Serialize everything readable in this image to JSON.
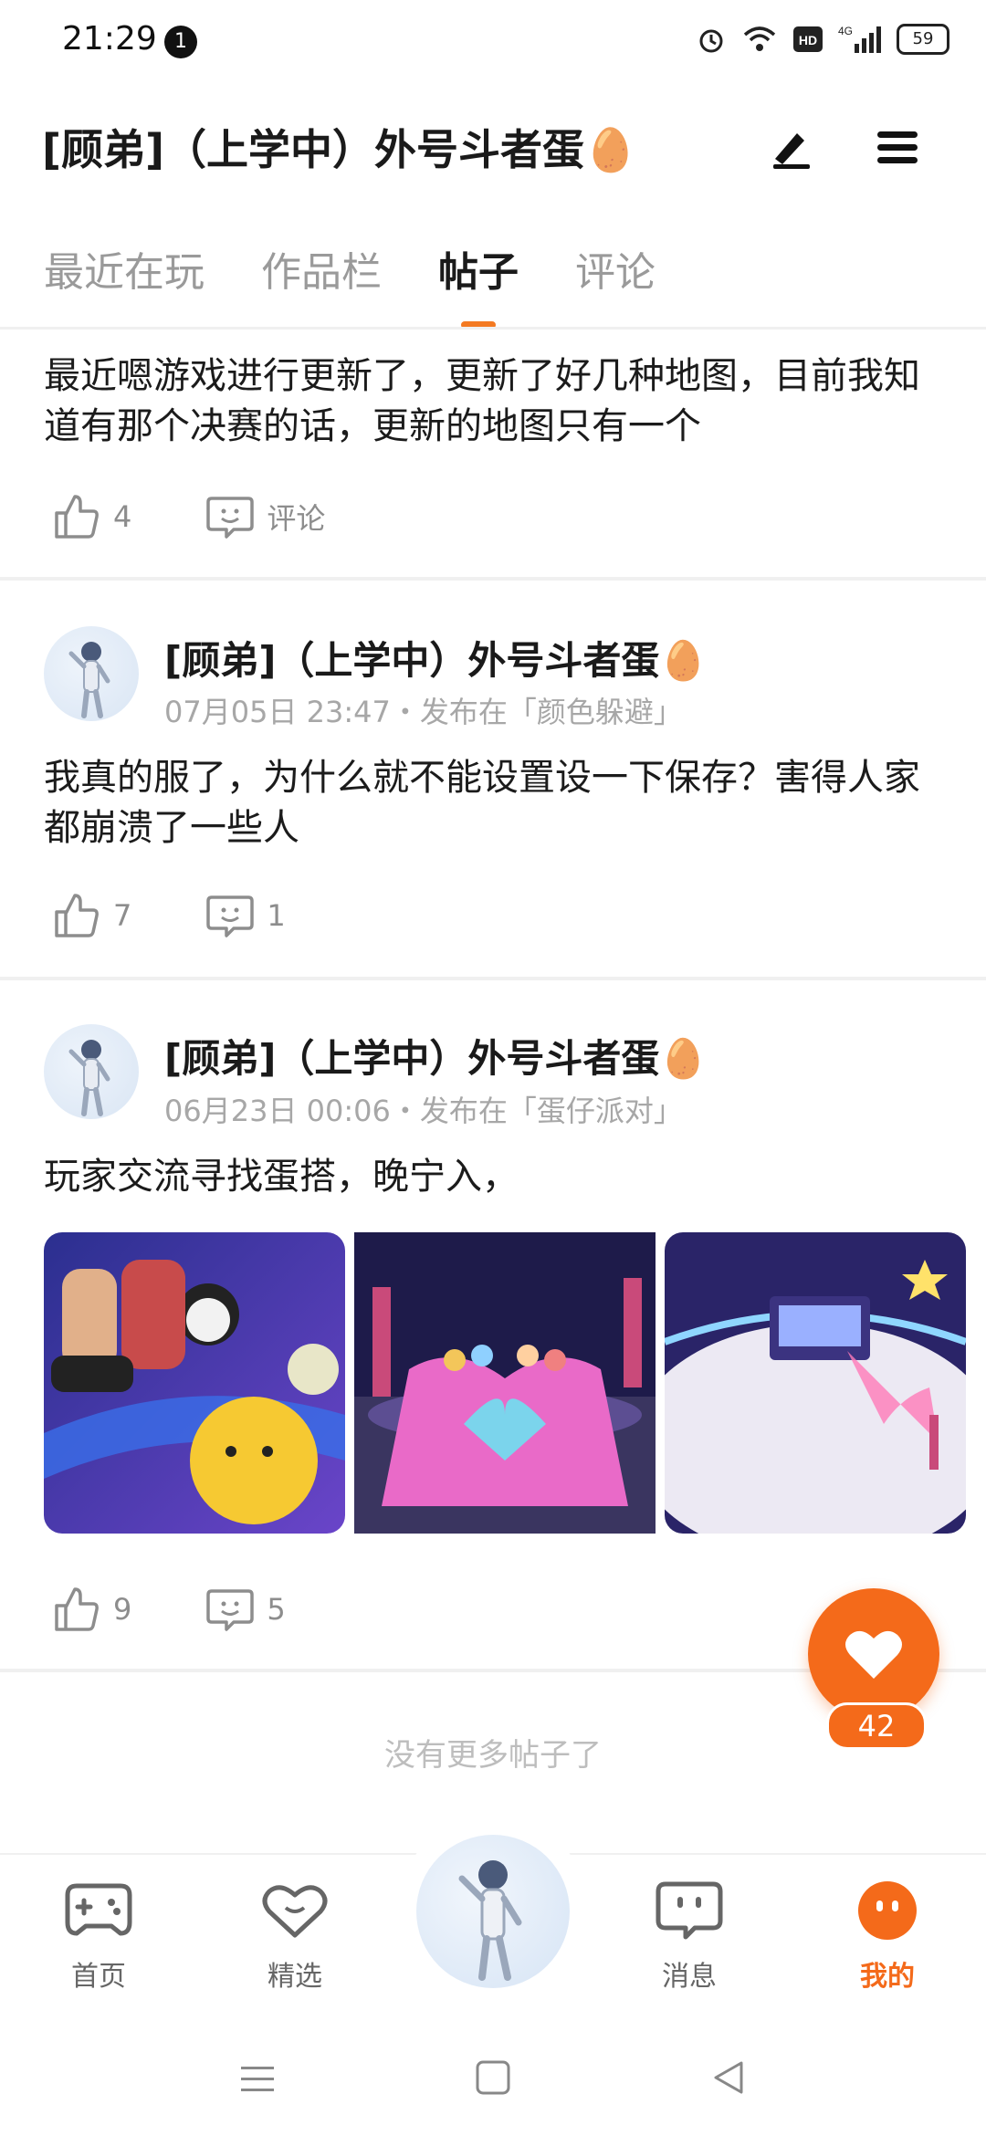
{
  "status_bar": {
    "time": "21:29",
    "notification_count": "1",
    "battery": "59",
    "network": "4G"
  },
  "header": {
    "title": "[顾弟]（上学中）外号斗者蛋🥚"
  },
  "tabs": [
    {
      "label": "最近在玩"
    },
    {
      "label": "作品栏"
    },
    {
      "label": "帖子",
      "active": true
    },
    {
      "label": "评论"
    }
  ],
  "posts": [
    {
      "text": "最近嗯游戏进行更新了，更新了好几种地图，目前我知道有那个决赛的话，更新的地图只有一个",
      "likes": "4",
      "comments": "评论"
    },
    {
      "author": "[顾弟]（上学中）外号斗者蛋🥚",
      "meta": "07月05日 23:47・发布在「颜色躲避」",
      "text": "我真的服了，为什么就不能设置设一下保存？害得人家都崩溃了一些人",
      "likes": "7",
      "comments": "1"
    },
    {
      "author": "[顾弟]（上学中）外号斗者蛋🥚",
      "meta": "06月23日 00:06・发布在「蛋仔派对」",
      "text": "玩家交流寻找蛋搭，晚宁入，",
      "likes": "9",
      "comments": "5"
    }
  ],
  "fab": {
    "count": "42"
  },
  "footer": {
    "no_more": "没有更多帖子了"
  },
  "bottom_nav": [
    {
      "label": "首页"
    },
    {
      "label": "精选"
    },
    {
      "label": "消息"
    },
    {
      "label": "我的",
      "active": true
    }
  ],
  "colors": {
    "accent": "#f46a1a",
    "muted": "#9a9a9a"
  }
}
